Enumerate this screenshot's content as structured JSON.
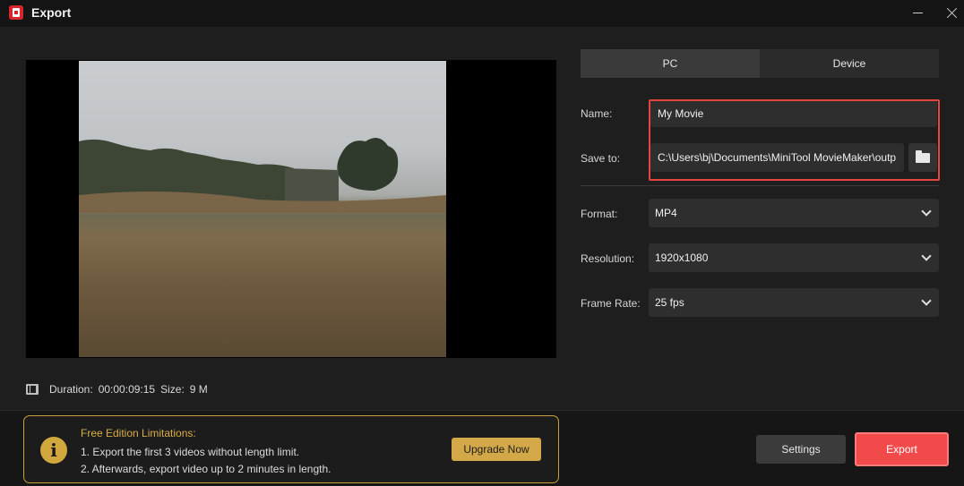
{
  "window": {
    "title": "Export"
  },
  "preview": {
    "duration_label": "Duration:",
    "duration_value": "00:00:09:15",
    "size_label": "Size:",
    "size_value": "9 M"
  },
  "tabs": [
    {
      "label": "PC"
    },
    {
      "label": "Device"
    }
  ],
  "form": {
    "name_label": "Name:",
    "name_value": "My Movie",
    "save_to_label": "Save to:",
    "save_to_value": "C:\\Users\\bj\\Documents\\MiniTool MovieMaker\\outp",
    "format_label": "Format:",
    "format_value": "MP4",
    "resolution_label": "Resolution:",
    "resolution_value": "1920x1080",
    "frame_rate_label": "Frame Rate:",
    "frame_rate_value": "25 fps"
  },
  "limitations": {
    "title": "Free Edition Limitations:",
    "line1": "1. Export the first 3 videos without length limit.",
    "line2": "2. Afterwards, export video up to 2 minutes in length.",
    "upgrade_label": "Upgrade Now"
  },
  "actions": {
    "settings_label": "Settings",
    "export_label": "Export"
  },
  "colors": {
    "accent_red": "#f24a4a",
    "highlight_border": "#e2463e",
    "gold": "#d3a848"
  },
  "icons": {
    "app": "app-logo-icon",
    "minimize": "minimize-icon",
    "close": "close-icon",
    "film": "film-icon",
    "folder": "folder-icon",
    "info": "info-icon",
    "dropdown": "chevron-down-icon"
  }
}
